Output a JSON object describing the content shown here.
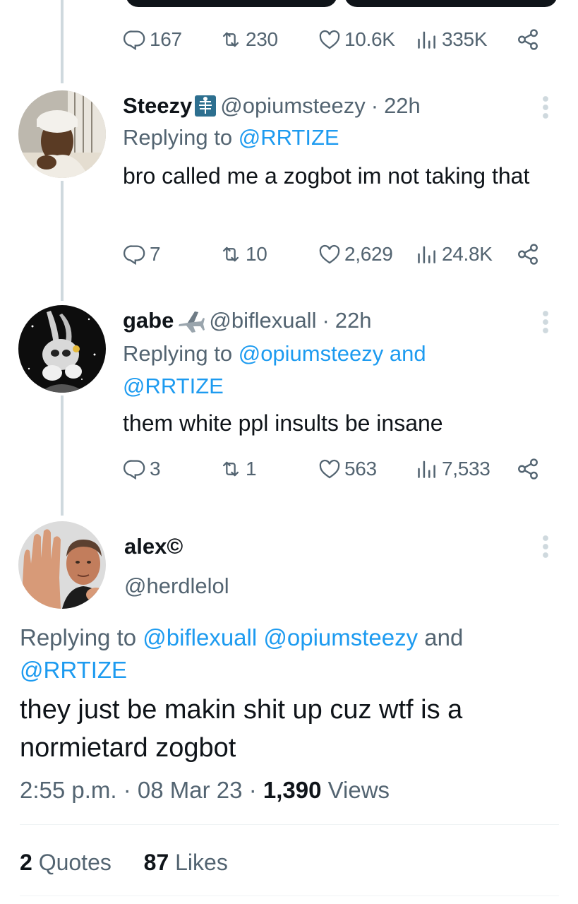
{
  "top_tweet": {
    "actions": {
      "replies": "167",
      "retweets": "230",
      "likes": "10.6K",
      "views": "335K"
    }
  },
  "replies": [
    {
      "name": "Steezy",
      "name_emoji": "x-ray-icon",
      "handle": "@opiumsteezy",
      "separator": "·",
      "time": "22h",
      "replying_prefix": "Replying to",
      "replying_to": [
        "@RRTIZE"
      ],
      "text": "bro called me a zogbot im not taking that",
      "actions": {
        "replies": "7",
        "retweets": "10",
        "likes": "2,629",
        "views": "24.8K"
      }
    },
    {
      "name": "gabe",
      "name_emoji": "airplane-icon",
      "handle": "@biflexuall",
      "separator": "·",
      "time": "22h",
      "replying_prefix": "Replying to",
      "replying_to": [
        "@opiumsteezy",
        "@RRTIZE"
      ],
      "replying_conjunction": "and",
      "text": "them white ppl insults be insane",
      "actions": {
        "replies": "3",
        "retweets": "1",
        "likes": "563",
        "views": "7,533"
      }
    }
  ],
  "main_tweet": {
    "name": "alex©",
    "handle": "@herdlelol",
    "replying_prefix": "Replying to",
    "replying_to": [
      "@biflexuall",
      "@opiumsteezy",
      "@RRTIZE"
    ],
    "replying_conjunction": "and",
    "text": "they just be makin shit up cuz wtf is a normietard zogbot",
    "time": "2:55 p.m.",
    "separator": "·",
    "date": "08 Mar 23",
    "views_count": "1,390",
    "views_label": "Views",
    "quotes_count": "2",
    "quotes_label": "Quotes",
    "likes_count": "87",
    "likes_label": "Likes"
  },
  "colors": {
    "text": "#0f1419",
    "secondary": "#536471",
    "link": "#1d9bf0",
    "thread_line": "#cfd9de",
    "divider": "#eff3f4"
  }
}
